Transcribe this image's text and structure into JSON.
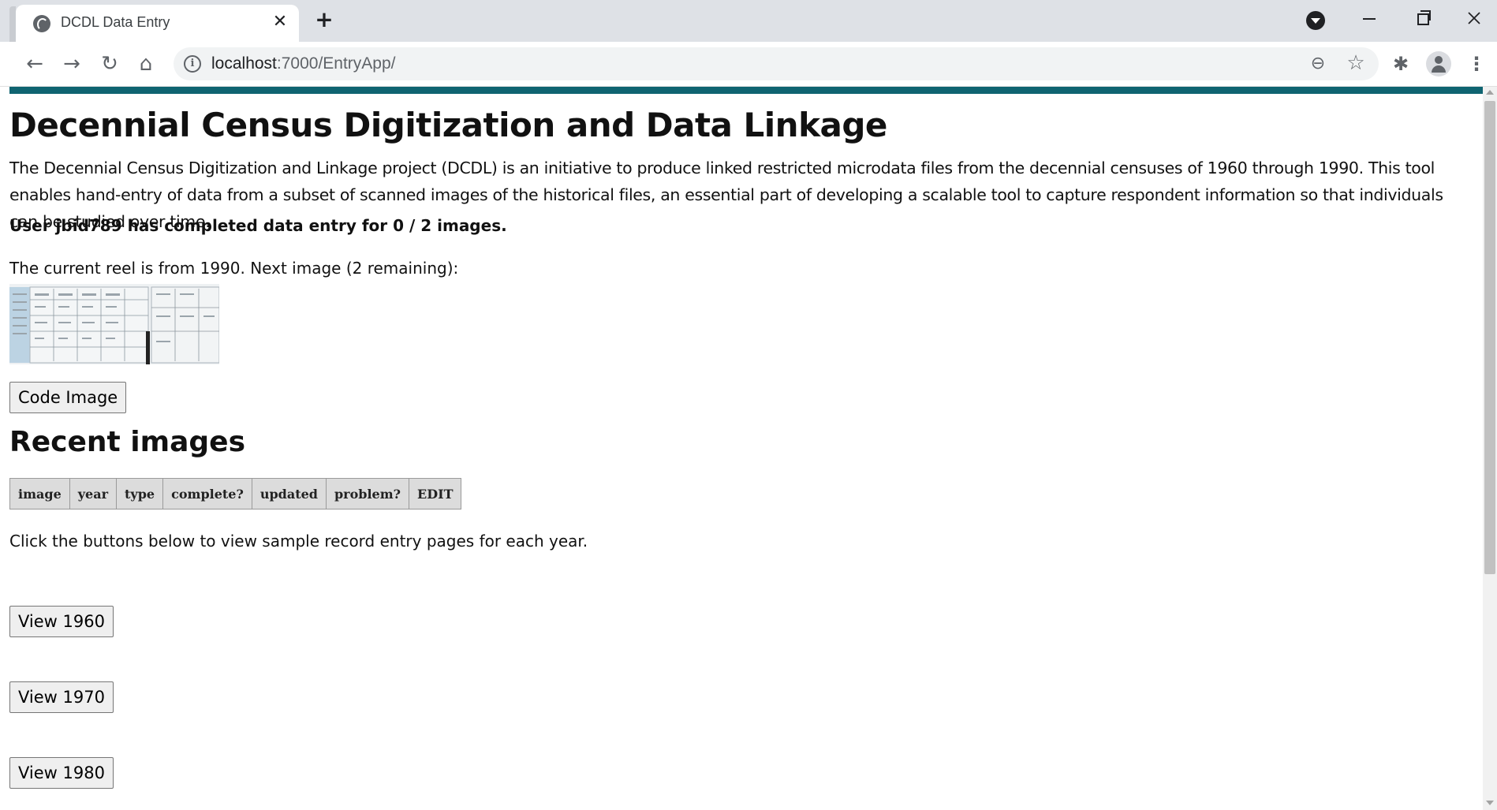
{
  "browser": {
    "tab_title": "DCDL Data Entry",
    "tab_close_glyph": "✕",
    "new_tab_glyph": "+",
    "url_host": "localhost",
    "url_path": ":7000/EntryApp/",
    "icons": [
      "globe-icon",
      "back-arrow-icon",
      "forward-arrow-icon",
      "reload-icon",
      "home-icon",
      "info-icon",
      "zoom-out-icon",
      "star-icon",
      "puzzle-extension-icon",
      "profile-icon",
      "kebab-menu-icon",
      "tab-search-icon"
    ],
    "glyphs": {
      "back": "←",
      "forward": "→",
      "reload": "↻",
      "home": "⌂",
      "info": "i",
      "zoom": "⊖",
      "star": "☆",
      "extension": "✱",
      "menu": "⋮"
    }
  },
  "page": {
    "title": "Decennial Census Digitization and Data Linkage",
    "intro": "The Decennial Census Digitization and Linkage project (DCDL) is an initiative to produce linked restricted microdata files from the decennial censuses of 1960 through 1990. This tool enables hand-entry of data from a subset of scanned images of the historical files, an essential part of developing a scalable tool to capture respondent information so that individuals can be studied over time.",
    "status": "User jbid789 has completed data entry for 0 / 2 images.",
    "reel_info": "The current reel is from 1990. Next image (2 remaining):",
    "code_button": "Code Image",
    "recent_title": "Recent images",
    "table_headers": [
      "image",
      "year",
      "type",
      "complete?",
      "updated",
      "problem?",
      "EDIT"
    ],
    "helper_text": "Click the buttons below to view sample record entry pages for each year.",
    "year_buttons": [
      "View 1960",
      "View 1970",
      "View 1980"
    ]
  },
  "colors": {
    "accent_bar": "#0f6471",
    "tabstrip": "#dee1e6",
    "omnibox": "#f1f3f4"
  }
}
